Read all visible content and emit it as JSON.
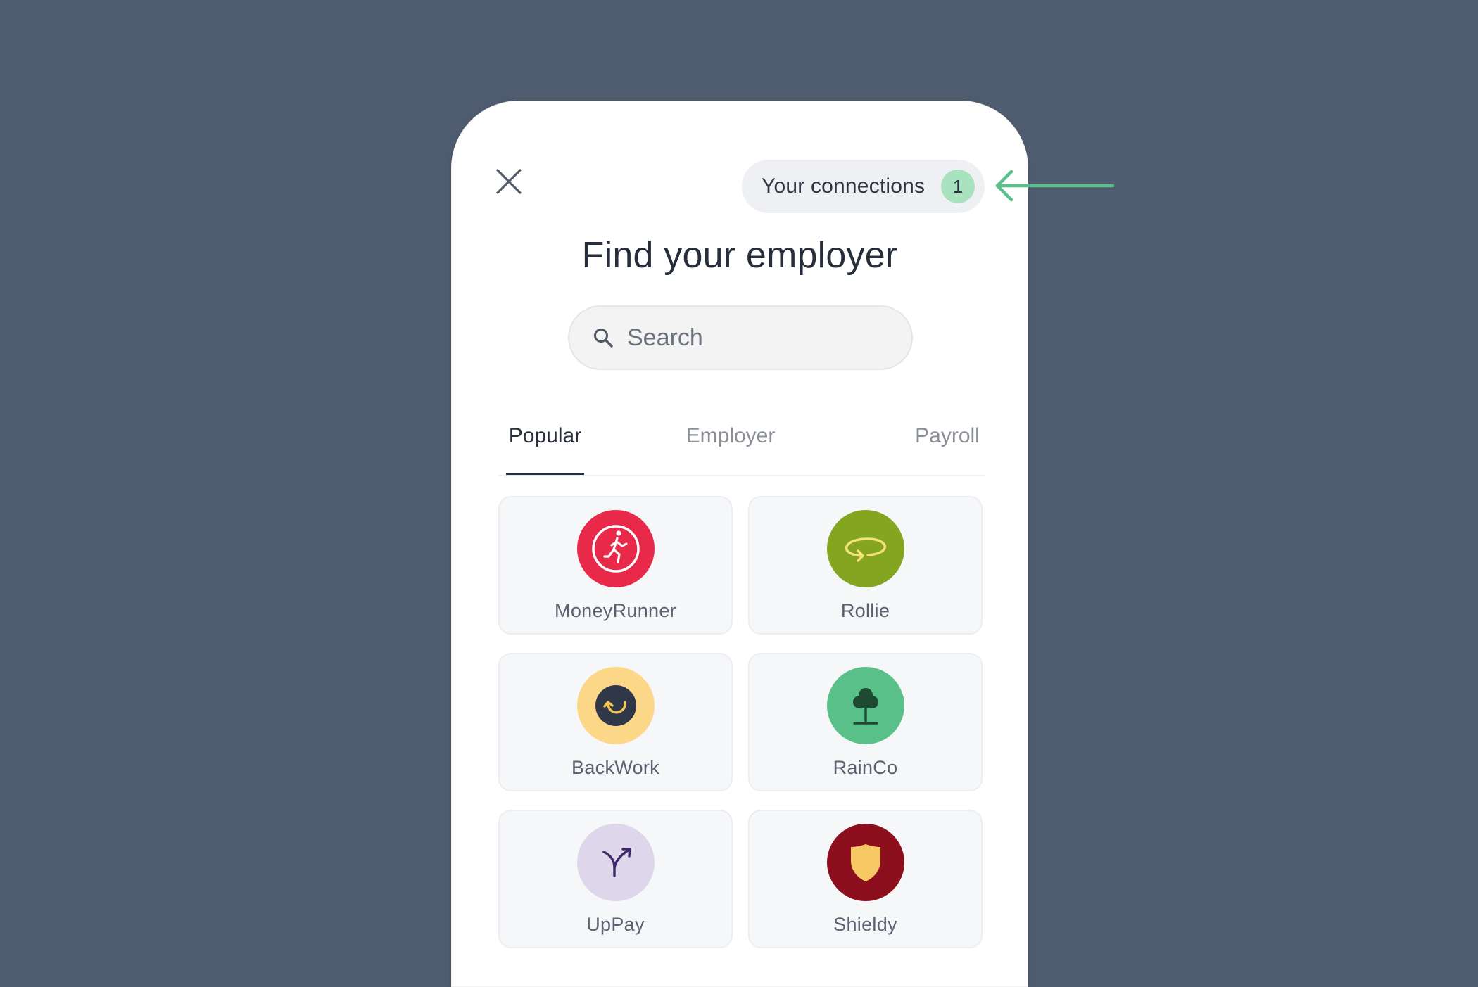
{
  "header": {
    "connections_label": "Your connections",
    "connections_count": "1"
  },
  "title": "Find your employer",
  "search": {
    "placeholder": "Search",
    "value": ""
  },
  "tabs": [
    {
      "label": "Popular",
      "active": true
    },
    {
      "label": "Employer",
      "active": false
    },
    {
      "label": "Payroll",
      "active": false
    }
  ],
  "employers": [
    {
      "name": "MoneyRunner",
      "icon": "running-person-icon",
      "color": "#e8294a"
    },
    {
      "name": "Rollie",
      "icon": "rotate-arrow-icon",
      "color": "#84a520"
    },
    {
      "name": "BackWork",
      "icon": "undo-arrow-icon",
      "color": "#fcd787"
    },
    {
      "name": "RainCo",
      "icon": "tree-icon",
      "color": "#5ac08a"
    },
    {
      "name": "UpPay",
      "icon": "split-arrow-icon",
      "color": "#ded6ea"
    },
    {
      "name": "Shieldy",
      "icon": "shield-icon",
      "color": "#8d0f1e"
    }
  ],
  "colors": {
    "background": "#4f5b6e",
    "accent": "#5ac08a",
    "badge": "#a8e2bf",
    "text": "#262e3b"
  }
}
